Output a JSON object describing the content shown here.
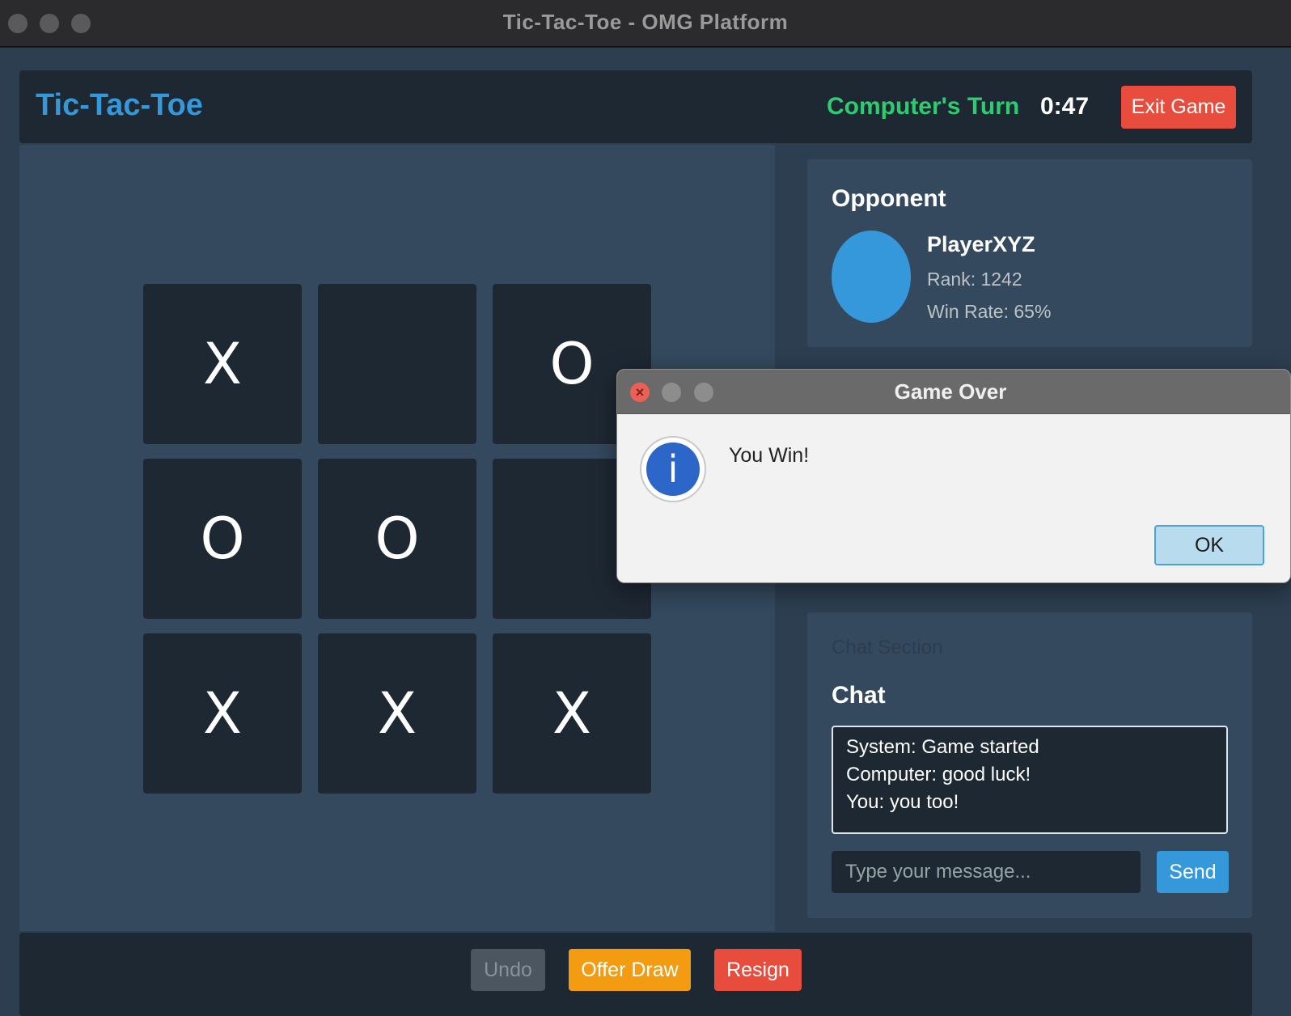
{
  "window": {
    "title": "Tic-Tac-Toe - OMG Platform"
  },
  "header": {
    "title": "Tic-Tac-Toe",
    "turn_status": "Computer's Turn",
    "timer": "0:47",
    "exit_label": "Exit Game"
  },
  "board": {
    "cells": [
      "X",
      "",
      "O",
      "O",
      "O",
      "",
      "X",
      "X",
      "X"
    ]
  },
  "opponent": {
    "heading": "Opponent",
    "name": "PlayerXYZ",
    "rank": "Rank: 1242",
    "win_rate": "Win Rate: 65%"
  },
  "chat": {
    "section_label": "Chat Section",
    "heading": "Chat",
    "messages": [
      "System: Game started",
      "Computer: good luck!",
      "You: you too!"
    ],
    "input_placeholder": "Type your message...",
    "send_label": "Send"
  },
  "footer": {
    "undo_label": "Undo",
    "offer_draw_label": "Offer Draw",
    "resign_label": "Resign"
  },
  "dialog": {
    "title": "Game Over",
    "message": "You Win!",
    "ok_label": "OK",
    "icon": "info-icon",
    "close_glyph": "×",
    "icon_glyph": "i"
  },
  "colors": {
    "accent_blue": "#3498db",
    "turn_green": "#2ecc71",
    "danger_red": "#e74c3c",
    "warning_orange": "#f39c12",
    "panel_dark": "#1e2833",
    "panel_mid": "#34495e"
  }
}
